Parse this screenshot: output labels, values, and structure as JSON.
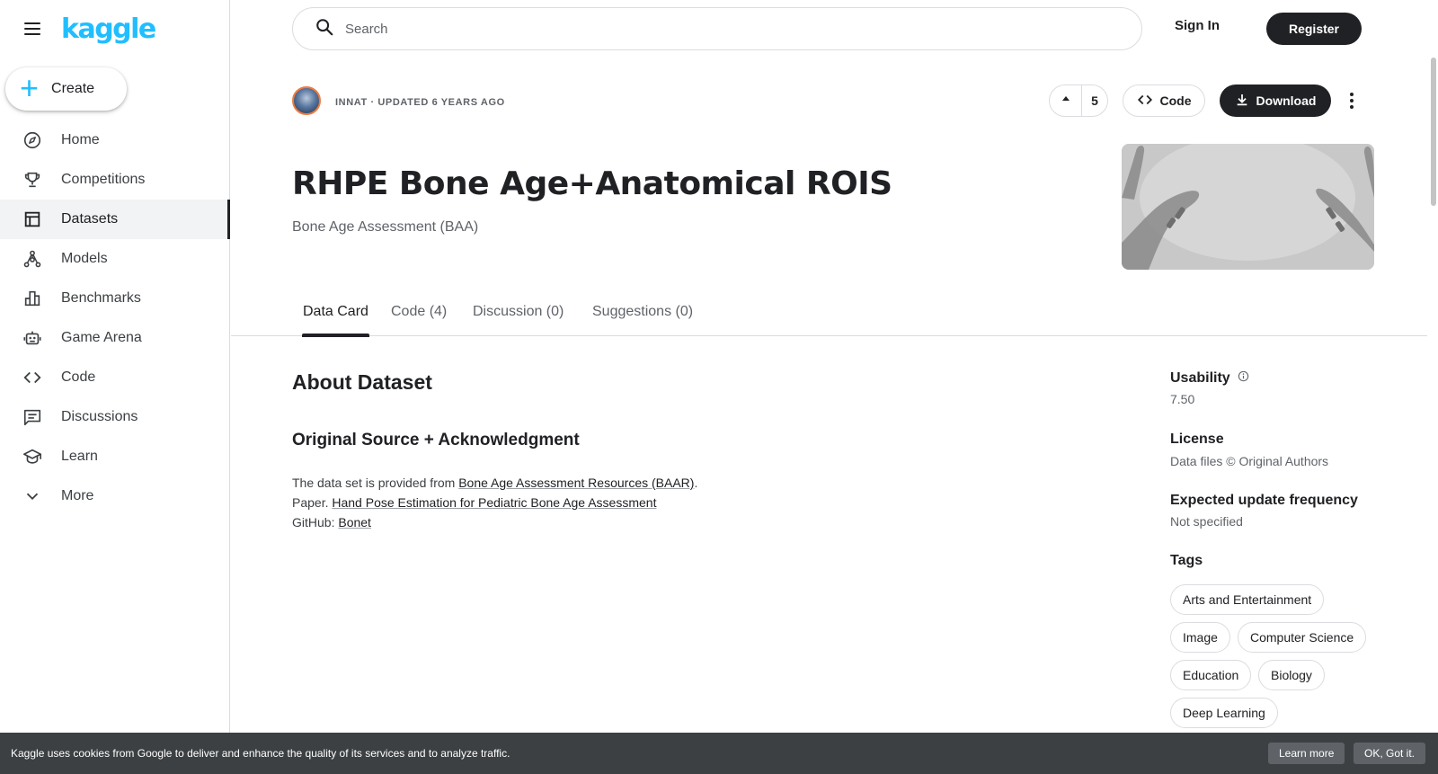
{
  "brand": {
    "logo_text": "kaggle",
    "color": "#20beff"
  },
  "sidebar": {
    "create_label": "Create",
    "items": [
      {
        "label": "Home",
        "icon": "compass-icon"
      },
      {
        "label": "Competitions",
        "icon": "trophy-icon"
      },
      {
        "label": "Datasets",
        "icon": "table-icon",
        "active": true
      },
      {
        "label": "Models",
        "icon": "models-icon"
      },
      {
        "label": "Benchmarks",
        "icon": "bar-chart-icon"
      },
      {
        "label": "Game Arena",
        "icon": "robot-icon"
      },
      {
        "label": "Code",
        "icon": "code-icon"
      },
      {
        "label": "Discussions",
        "icon": "comment-icon"
      },
      {
        "label": "Learn",
        "icon": "school-icon"
      },
      {
        "label": "More",
        "icon": "chevron-down-icon"
      }
    ]
  },
  "search": {
    "placeholder": "Search"
  },
  "auth": {
    "signin_label": "Sign In",
    "register_label": "Register"
  },
  "dataset": {
    "owner_line": "INNAT · UPDATED 6 YEARS AGO",
    "vote_count": "5",
    "code_label": "Code",
    "download_label": "Download",
    "title": "RHPE Bone Age+Anatomical ROIS",
    "subtitle": "Bone Age Assessment (BAA)"
  },
  "tabs": [
    {
      "label": "Data Card",
      "active": true
    },
    {
      "label": "Code (4)"
    },
    {
      "label": "Discussion (0)"
    },
    {
      "label": "Suggestions (0)"
    }
  ],
  "content": {
    "about_heading": "About Dataset",
    "source_heading": "Original Source + Acknowledgment",
    "line1_prefix": "The data set is provided from ",
    "line1_link": "Bone Age Assessment Resources (BAAR)",
    "line1_suffix": ".",
    "line2_prefix": "Paper. ",
    "line2_link": "Hand Pose Estimation for Pediatric Bone Age Assessment",
    "line3_prefix": "GitHub: ",
    "line3_link": "Bonet"
  },
  "meta": {
    "usability_label": "Usability",
    "usability_value": "7.50",
    "license_label": "License",
    "license_value": "Data files © Original Authors",
    "frequency_label": "Expected update frequency",
    "frequency_value": "Not specified",
    "tags_label": "Tags",
    "tags": [
      "Arts and Entertainment",
      "Image",
      "Computer Science",
      "Education",
      "Biology",
      "Deep Learning"
    ]
  },
  "cookie": {
    "message": "Kaggle uses cookies from Google to deliver and enhance the quality of its services and to analyze traffic.",
    "learn_more_label": "Learn more",
    "ok_label": "OK, Got it."
  }
}
